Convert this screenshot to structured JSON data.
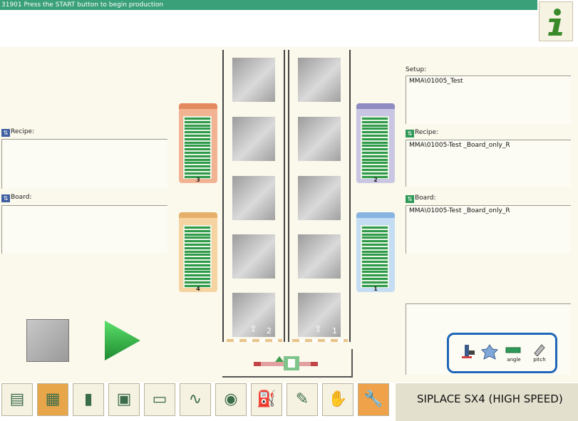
{
  "title_bar": {
    "message": "31901 Press the START button to begin production"
  },
  "left_panel": {
    "recipe_label": "Recipe:",
    "recipe_value": "",
    "board_label": "Board:",
    "board_value": ""
  },
  "right_panel": {
    "setup_label": "Setup:",
    "setup_value": "MMA\\01005_Test",
    "recipe_label": "Recipe:",
    "recipe_value": "MMA\\01005-Test _Board_only_R",
    "board_label": "Board:",
    "board_value": "MMA\\01005-Test _Board_only_R"
  },
  "feeders": [
    {
      "number": "3",
      "color": "#f2b393",
      "header": "#e28a5e"
    },
    {
      "number": "4",
      "color": "#f5d4a2",
      "header": "#e6b06a"
    },
    {
      "number": "2",
      "color": "#c8c6e2",
      "header": "#8e8cc0"
    },
    {
      "number": "1",
      "color": "#c5ddf3",
      "header": "#88b4e2"
    }
  ],
  "conveyor": {
    "left_lane_number": "2",
    "right_lane_number": "1"
  },
  "controls": {
    "stop_icon": "stop-button-icon",
    "start_icon": "start-play-icon"
  },
  "highlight_icons": {
    "angle_label": "angle",
    "pitch_label": "pitch",
    "highlight_color": "#1f66b8"
  },
  "toolbar": {
    "icons": [
      "money-stack-icon",
      "grid-table-icon",
      "bar-chart-icon",
      "circuit-board-icon",
      "feeder-unit-icon",
      "line-graph-icon",
      "camera-lens-icon",
      "oil-can-icon",
      "pen-icon",
      "hand-gear-icon",
      "wrench-icon"
    ]
  },
  "machine_name": "SIPLACE SX4 (HIGH SPEED)"
}
